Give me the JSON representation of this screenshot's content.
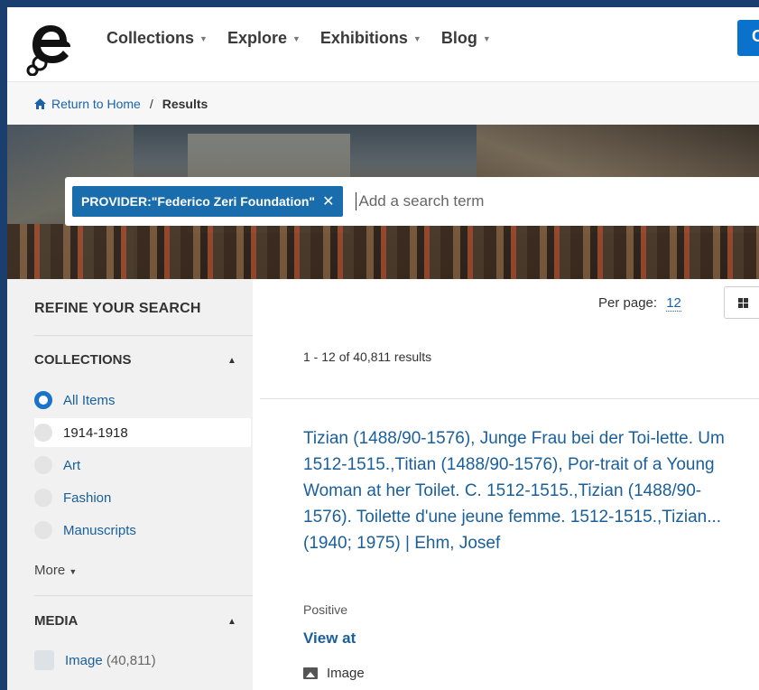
{
  "header": {
    "nav": [
      {
        "label": "Collections"
      },
      {
        "label": "Explore"
      },
      {
        "label": "Exhibitions"
      },
      {
        "label": "Blog"
      }
    ],
    "button_label": "C"
  },
  "breadcrumb": {
    "home": "Return to Home",
    "separator": "/",
    "current": "Results"
  },
  "search": {
    "chip_label": "PROVIDER:\"Federico Zeri Foundation\"",
    "chip_close": "✕",
    "placeholder": "Add a search term"
  },
  "sidebar": {
    "title": "REFINE YOUR SEARCH",
    "collections": {
      "heading": "COLLECTIONS",
      "options": [
        {
          "label": "All Items",
          "selected": true
        },
        {
          "label": "1914-1918",
          "selected": false
        },
        {
          "label": "Art",
          "selected": false
        },
        {
          "label": "Fashion",
          "selected": false
        },
        {
          "label": "Manuscripts",
          "selected": false
        }
      ],
      "more_label": "More"
    },
    "media": {
      "heading": "MEDIA",
      "options": [
        {
          "label": "Image",
          "count": "(40,811)"
        }
      ]
    }
  },
  "main": {
    "per_page_label": "Per page:",
    "per_page_value": "12",
    "results_count": "1 - 12 of 40,811 results",
    "result": {
      "title": "Tizian (1488/90-1576), Junge Frau bei der Toi-lette. Um 1512-1515.,Titian (1488/90-1576), Por-trait of a Young Woman at her Toilet. C. 1512-1515.,Tizian (1488/90-1576). Toilette d'une jeune femme. 1512-1515.,Tizian... (1940; 1975) | Ehm, Josef",
      "type": "Positive",
      "view_at": "View at",
      "media_type": "Image"
    }
  },
  "colors": {
    "frame": "#1a3f6e",
    "accent": "#1a6dac",
    "link": "#1a5f99"
  }
}
